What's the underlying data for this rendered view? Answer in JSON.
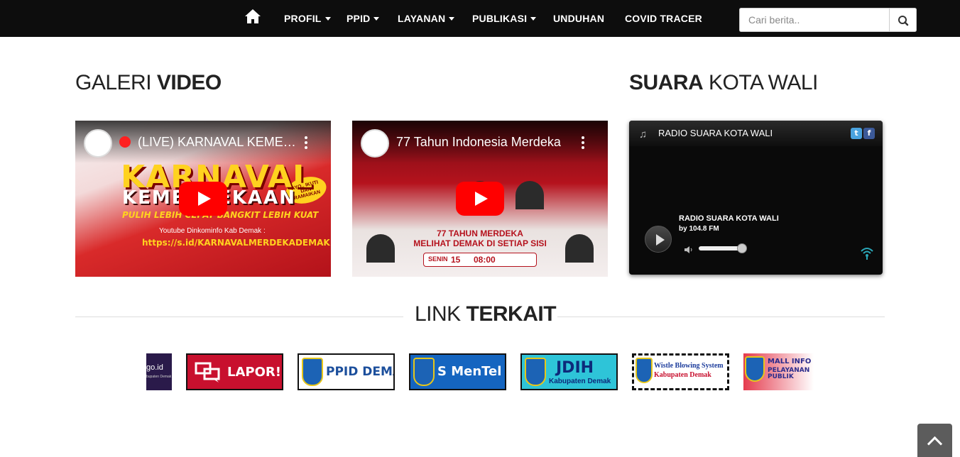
{
  "nav": {
    "items": [
      {
        "label": "PROFIL",
        "dropdown": true
      },
      {
        "label": "PPID",
        "dropdown": true
      },
      {
        "label": "LAYANAN",
        "dropdown": true
      },
      {
        "label": "PUBLIKASI",
        "dropdown": true
      },
      {
        "label": "UNDUHAN",
        "dropdown": false
      },
      {
        "label": "COVID TRACER",
        "dropdown": false
      }
    ],
    "home_icon": "home-icon",
    "search": {
      "placeholder": "Cari berita..",
      "value": "",
      "icon": "search-icon"
    }
  },
  "gallery": {
    "title_light": "GALERI",
    "title_bold": "VIDEO",
    "videos": [
      {
        "title": "(LIVE) KARNAVAL KEMERDEKAAN",
        "thumb_heading": "KARNAVAL",
        "thumb_sub": "KEMERDEKAAN",
        "thumb_tagline": "PULIH LEBIH CEPAT BANGKIT LEBIH KUAT",
        "thumb_badge": "AYO.. IKUTI DAN RAMAIKAN",
        "thumb_channel": "Youtube Dinkominfo Kab Demak :",
        "thumb_url": "https://s.id/KARNAVALMERDEKADEMAK"
      },
      {
        "title": "77 Tahun Indonesia Merdeka",
        "thumb_line1": "77 TAHUN MERDEKA",
        "thumb_line2": "MELIHAT DEMAK DI SETIAP SISI",
        "thumb_day": "SENIN",
        "thumb_date": "15",
        "thumb_time": "08:00"
      }
    ]
  },
  "radio_section": {
    "title_bold": "SUARA",
    "title_light": "KOTA WALI",
    "player": {
      "name": "RADIO SUARA KOTA WALI",
      "station": "RADIO SUARA KOTA WALI",
      "frequency": "by 104.8 FM",
      "volume_level": 0.95
    }
  },
  "links": {
    "title_light": "LINK",
    "title_bold": "TERKAIT",
    "banners": [
      {
        "label": "go.id",
        "sub": "bupaten Demak"
      },
      {
        "label": "LAPOR!"
      },
      {
        "label": "PPID DEMAK"
      },
      {
        "label": "S MenTel"
      },
      {
        "label": "JDIH",
        "sub": "Kabupaten Demak"
      },
      {
        "label": "Wistle Blowing System",
        "sub": "Kabupaten Demak"
      },
      {
        "label": "MALL INFO",
        "sub": "PELAYANAN PUBLIK"
      }
    ]
  },
  "colors": {
    "navbar": "#0d0d0d",
    "youtube_red": "#ff0000",
    "lapor_red": "#c8102e",
    "mentel_blue": "#1565c0",
    "jdih_cyan": "#2ec4d8"
  }
}
